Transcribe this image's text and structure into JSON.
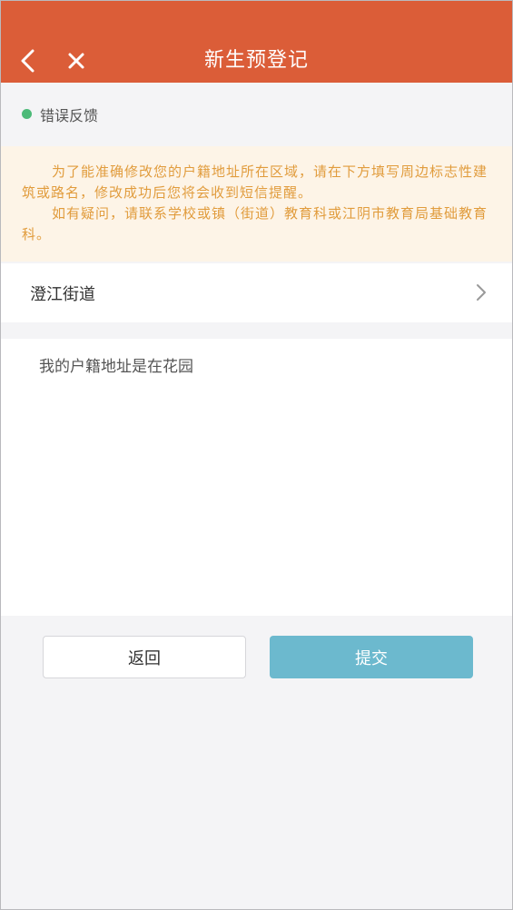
{
  "header": {
    "title": "新生预登记",
    "background_color": "#db5d38",
    "back_icon": "chevron-left-icon",
    "close_icon": "close-icon"
  },
  "feedback": {
    "label": "错误反馈",
    "dot_color": "#4cba78"
  },
  "notice": {
    "paragraphs": [
      "为了能准确修改您的户籍地址所在区域，请在下方填写周边标志性建筑或路名，修改成功后您将会收到短信提醒。",
      "如有疑问，请联系学校或镇（街道）教育科或江阴市教育局基础教育科。"
    ],
    "text_color": "#e19c3d",
    "background_color": "#fdf4e7"
  },
  "street_select": {
    "value": "澄江街道",
    "chevron_icon": "chevron-right-icon"
  },
  "address_input": {
    "value": "我的户籍地址是在花园"
  },
  "buttons": {
    "back_label": "返回",
    "submit_label": "提交",
    "submit_color": "#6cb9ce"
  }
}
